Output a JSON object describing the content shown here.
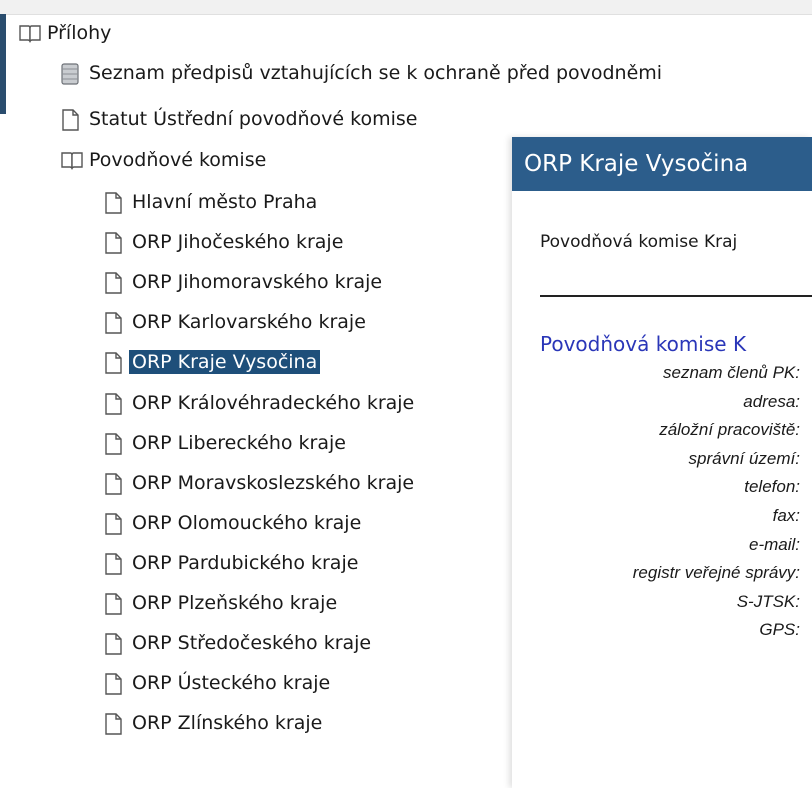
{
  "tree": {
    "root": {
      "label": "Přílohy"
    },
    "items": [
      {
        "label": "Seznam předpisů vztahujících se k ochraně před povodněmi",
        "icon": "book-stack-icon"
      },
      {
        "label": "Statut Ústřední povodňové komise",
        "icon": "document-icon"
      },
      {
        "label": "Povodňové komise",
        "icon": "open-book-icon"
      }
    ],
    "commissions": [
      "Hlavní město Praha",
      "ORP Jihočeského kraje",
      "ORP Jihomoravského kraje",
      "ORP Karlovarského kraje",
      "ORP Kraje Vysočina",
      "ORP Královéhradeckého kraje",
      "ORP Libereckého kraje",
      "ORP Moravskoslezského kraje",
      "ORP Olomouckého kraje",
      "ORP Pardubického kraje",
      "ORP Plzeňského kraje",
      "ORP Středočeského kraje",
      "ORP Ústeckého kraje",
      "ORP Zlínského kraje"
    ],
    "selected": "ORP Kraje Vysočina"
  },
  "panel": {
    "title": "ORP Kraje Vysočina",
    "intro": "Povodňová komise Kraj",
    "subtitle": "Povodňová komise K",
    "fields": [
      "seznam členů PK:",
      "adresa:",
      "záložní pracoviště:",
      "správní území:",
      "telefon:",
      "fax:",
      "e-mail:",
      "registr veřejné správy:",
      "S-JTSK:",
      "GPS:"
    ]
  },
  "colors": {
    "selection": "#1e4f7a",
    "header": "#2c5d8b",
    "subtitle": "#2a36b8",
    "sidebar_accent": "#2a4d6e"
  }
}
